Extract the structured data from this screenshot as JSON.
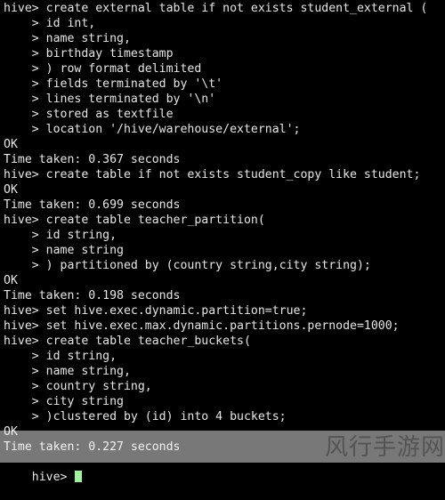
{
  "terminal": {
    "background_color": "#000000",
    "foreground_color": "#e6e6e6",
    "cursor_color": "#9ff09f",
    "prompt": "hive>",
    "continuation_prompt": ">",
    "lines": [
      "hive> create external table if not exists student_external (",
      "    > id int,",
      "    > name string,",
      "    > birthday timestamp",
      "    > ) row format delimited",
      "    > fields terminated by '\\t'",
      "    > lines terminated by '\\n'",
      "    > stored as textfile",
      "    > location '/hive/warehouse/external';",
      "OK",
      "Time taken: 0.367 seconds",
      "hive> create table if not exists student_copy like student;",
      "OK",
      "Time taken: 0.699 seconds",
      "hive> create table teacher_partition(",
      "    > id string,",
      "    > name string",
      "    > ) partitioned by (country string,city string);",
      "OK",
      "Time taken: 0.198 seconds",
      "hive> set hive.exec.dynamic.partition=true;",
      "hive> set hive.exec.max.dynamic.partitions.pernode=1000;",
      "hive> create table teacher_buckets(",
      "    > id string,",
      "    > name string,",
      "    > country string,",
      "    > city string",
      "    > )clustered by (id) into 4 buckets;",
      "OK",
      "Time taken: 0.227 seconds"
    ],
    "prompt_line": "hive> "
  },
  "watermark": {
    "text": "风行手游网",
    "band_color": "rgba(255,255,255,0.47)",
    "text_color": "rgba(40,40,40,0.45)"
  }
}
